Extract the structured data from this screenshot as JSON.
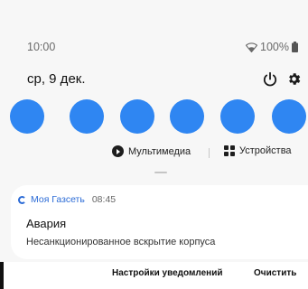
{
  "status_bar": {
    "time": "10:00",
    "battery": "100%",
    "icons": [
      "wifi-icon",
      "battery-icon"
    ]
  },
  "header": {
    "date": "ср, 9 дек.",
    "icons": [
      "power-icon",
      "gear-icon"
    ]
  },
  "quick_toggles": {
    "count": 6,
    "color": "#2f86f2"
  },
  "media_row": {
    "media_label": "Мультимедиа",
    "devices_label": "Устройства"
  },
  "notification": {
    "app_name": "Моя Газсеть",
    "time": "08:45",
    "title": "Авария",
    "text": "Несанкционированное вскрытие корпуса",
    "accent": "#2b6bd6"
  },
  "footer": {
    "settings_label": "Настройки уведомлений",
    "clear_label": "Очистить"
  }
}
